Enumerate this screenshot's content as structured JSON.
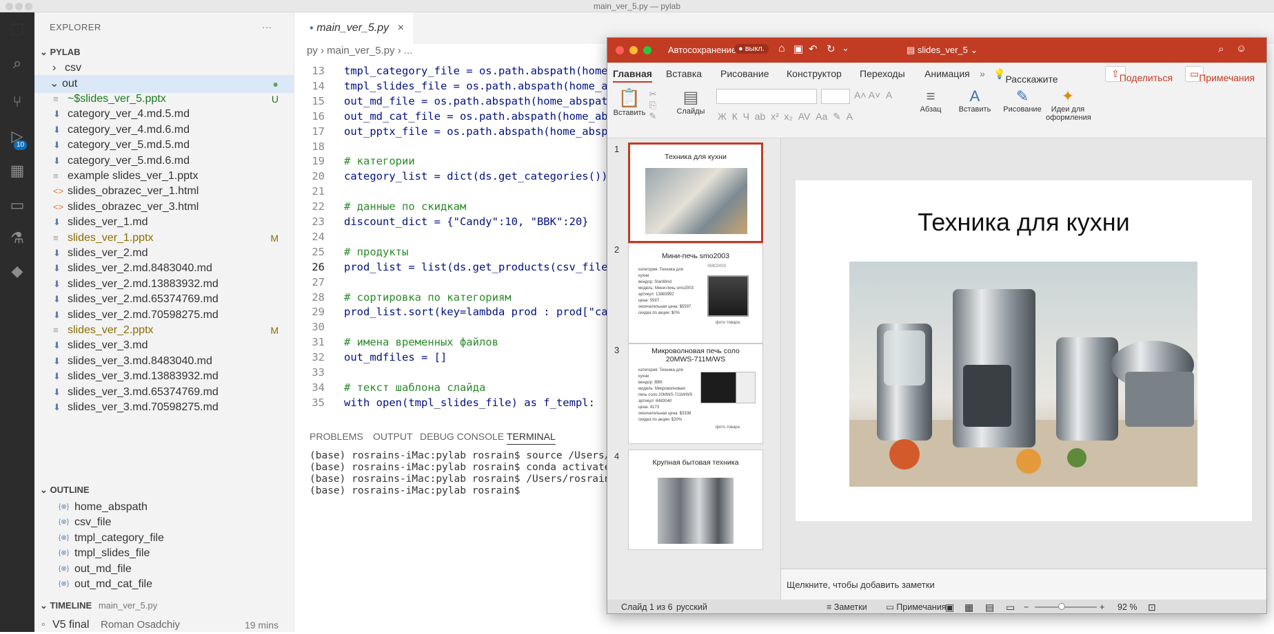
{
  "window_title": "main_ver_5.py — pylab",
  "explorer": {
    "header": "EXPLORER",
    "more": "···",
    "project": "PYLAB",
    "folder_csv": "csv",
    "folder_out": "out",
    "files": [
      {
        "name": "~$slides_ver_5.pptx",
        "status": "U"
      },
      {
        "name": "category_ver_4.md.5.md",
        "status": ""
      },
      {
        "name": "category_ver_4.md.6.md",
        "status": ""
      },
      {
        "name": "category_ver_5.md.5.md",
        "status": ""
      },
      {
        "name": "category_ver_5.md.6.md",
        "status": ""
      },
      {
        "name": "example slides_ver_1.pptx",
        "status": ""
      },
      {
        "name": "slides_obrazec_ver_1.html",
        "status": ""
      },
      {
        "name": "slides_obrazec_ver_3.html",
        "status": ""
      },
      {
        "name": "slides_ver_1.md",
        "status": ""
      },
      {
        "name": "slides_ver_1.pptx",
        "status": "M"
      },
      {
        "name": "slides_ver_2.md",
        "status": ""
      },
      {
        "name": "slides_ver_2.md.8483040.md",
        "status": ""
      },
      {
        "name": "slides_ver_2.md.13883932.md",
        "status": ""
      },
      {
        "name": "slides_ver_2.md.65374769.md",
        "status": ""
      },
      {
        "name": "slides_ver_2.md.70598275.md",
        "status": ""
      },
      {
        "name": "slides_ver_2.pptx",
        "status": "M"
      },
      {
        "name": "slides_ver_3.md",
        "status": ""
      },
      {
        "name": "slides_ver_3.md.8483040.md",
        "status": ""
      },
      {
        "name": "slides_ver_3.md.13883932.md",
        "status": ""
      },
      {
        "name": "slides_ver_3.md.65374769.md",
        "status": ""
      },
      {
        "name": "slides_ver_3.md.70598275.md",
        "status": ""
      }
    ],
    "source_control_badge": "10"
  },
  "outline": {
    "header": "OUTLINE",
    "items": [
      "home_abspath",
      "csv_file",
      "tmpl_category_file",
      "tmpl_slides_file",
      "out_md_file",
      "out_md_cat_file"
    ]
  },
  "timeline": {
    "header": "TIMELINE",
    "file": "main_ver_5.py",
    "commit": "V5 final",
    "author": "Roman Osadchiy",
    "time": "19 mins"
  },
  "editor": {
    "tab_label": "main_ver_5.py",
    "breadcrumb": "py  ›  main_ver_5.py  ›  ...",
    "lines": [
      {
        "n": "13",
        "code": "tmpl_category_file = os.path.abspath(home_a"
      },
      {
        "n": "14",
        "code": "tmpl_slides_file = os.path.abspath(home_abs"
      },
      {
        "n": "15",
        "code": "out_md_file = os.path.abspath(home_abspath"
      },
      {
        "n": "16",
        "code": "out_md_cat_file = os.path.abspath(home_absp"
      },
      {
        "n": "17",
        "code": "out_pptx_file = os.path.abspath(home_abspat"
      },
      {
        "n": "18",
        "code": ""
      },
      {
        "n": "19",
        "code": "# категории"
      },
      {
        "n": "20",
        "code": "category_list = dict(ds.get_categories())"
      },
      {
        "n": "21",
        "code": ""
      },
      {
        "n": "22",
        "code": "# данные по скидкам"
      },
      {
        "n": "23",
        "code": "discount_dict = {\"Candy\":10, \"BBK\":20}"
      },
      {
        "n": "24",
        "code": ""
      },
      {
        "n": "25",
        "code": "# продукты"
      },
      {
        "n": "26",
        "code": "prod_list = list(ds.get_products(csv_file))"
      },
      {
        "n": "27",
        "code": ""
      },
      {
        "n": "28",
        "code": "# сортировка по категориям"
      },
      {
        "n": "29",
        "code": "prod_list.sort(key=lambda prod : prod[\"cate"
      },
      {
        "n": "30",
        "code": ""
      },
      {
        "n": "31",
        "code": "# имена временных файлов"
      },
      {
        "n": "32",
        "code": "out_mdfiles = []"
      },
      {
        "n": "33",
        "code": ""
      },
      {
        "n": "34",
        "code": "# текст шаблона слайда"
      },
      {
        "n": "35",
        "code": "with open(tmpl_slides_file) as f_templ:"
      }
    ]
  },
  "panel": {
    "tabs": [
      "PROBLEMS",
      "OUTPUT",
      "DEBUG CONSOLE",
      "TERMINAL"
    ],
    "terminal": [
      "(base) rosrains-iMac:pylab rosrain$ source /Users/rosr",
      "(base) rosrains-iMac:pylab rosrain$ conda activate bas",
      "(base) rosrains-iMac:pylab rosrain$ /Users/rosrain/ana",
      "(base) rosrains-iMac:pylab rosrain$"
    ]
  },
  "ppt": {
    "autosave": "Автосохранение",
    "autosave_state": "выкл.",
    "doc_title": "slides_ver_5",
    "ribbon_tabs": [
      "Главная",
      "Вставка",
      "Рисование",
      "Конструктор",
      "Переходы",
      "Анимация"
    ],
    "tell_me": "Расскажите",
    "share": "Поделиться",
    "comments": "Примечания",
    "ribbon_buttons": {
      "paste": "Вставить",
      "slides": "Слайды",
      "paragraph": "Абзац",
      "insert": "Вставить",
      "drawing": "Рисование",
      "design_ideas": "Идеи для оформления"
    },
    "slides": [
      {
        "num": "1",
        "title": "Техника для кухни"
      },
      {
        "num": "2",
        "title": "Мини-печь smo2003",
        "bullets": [
          "категория: Техника для кухни",
          "вендор: StarWind",
          "модель: Мини-печь smo2003",
          "артикул: 13883992",
          "цена: 5597",
          "окончательная цена: $5597",
          "скидка по акции: $0%"
        ],
        "caption": "SMO2003",
        "photo_note": "фото товара"
      },
      {
        "num": "3",
        "title": "Микроволновая печь соло 20MWS-711M/WS",
        "bullets": [
          "категория: Техника для кухни",
          "вендор: BBK",
          "модель: Микроволновая печь соло 20MWS-711M/WS",
          "артикул: 8483040",
          "цена: 4173",
          "окончательная цена: $3338",
          "скидка по акции: $20%"
        ],
        "photo_note": "фото товара"
      },
      {
        "num": "4",
        "title": "Крупная бытовая техника"
      }
    ],
    "main_slide_title": "Техника для кухни",
    "notes_placeholder": "Щелкните, чтобы добавить заметки",
    "status": {
      "slide": "Слайд 1 из 6",
      "lang": "русский",
      "notes": "Заметки",
      "comments": "Примечания",
      "zoom": "92 %"
    },
    "colors": {
      "accent": "#c23b23"
    }
  }
}
